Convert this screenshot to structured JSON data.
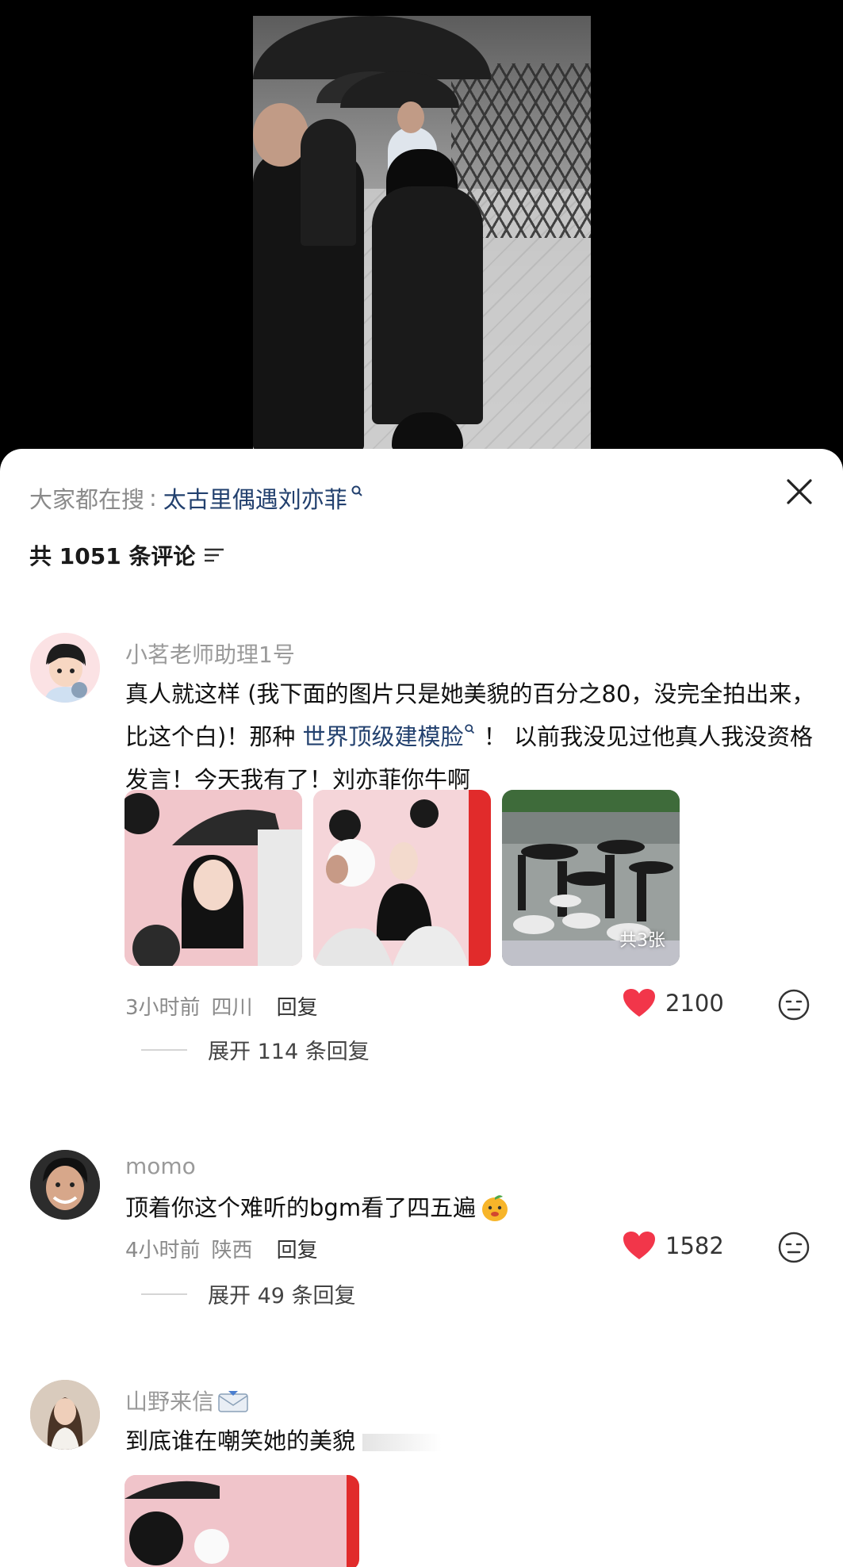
{
  "search_bar": {
    "prefix": "大家都在搜",
    "colon": ":",
    "term": "太古里偶遇刘亦菲"
  },
  "comments_header": {
    "count_label": "共 1051 条评论"
  },
  "comments": [
    {
      "username": "小茗老师助理1号",
      "text_a": "真人就这样 (我下面的图片只是她美貌的百分之80，没完全拍出来，比这个白)！那种 ",
      "link": "世界顶级建模脸",
      "text_b": " ！ 以前我没见过他真人我没资格发言！今天我有了！刘亦菲你牛啊",
      "image_badge": "共3张",
      "time": "3小时前",
      "location": "四川",
      "reply_label": "回复",
      "likes": "2100",
      "expand_label": "展开 114 条回复"
    },
    {
      "username": "momo",
      "text": "顶着你这个难听的bgm看了四五遍",
      "time": "4小时前",
      "location": "陕西",
      "reply_label": "回复",
      "likes": "1582",
      "expand_label": "展开 49 条回复"
    },
    {
      "username": "山野来信",
      "text": "到底谁在嘲笑她的美貌"
    }
  ],
  "colors": {
    "like_heart": "#f2364a",
    "link": "#22406e",
    "muted": "#8a8a8a"
  },
  "icons": [
    "close-icon",
    "search-icon",
    "sort-icon",
    "heart-icon",
    "emoji-react-icon",
    "mango-emoji-icon",
    "envelope-emoji-icon"
  ]
}
